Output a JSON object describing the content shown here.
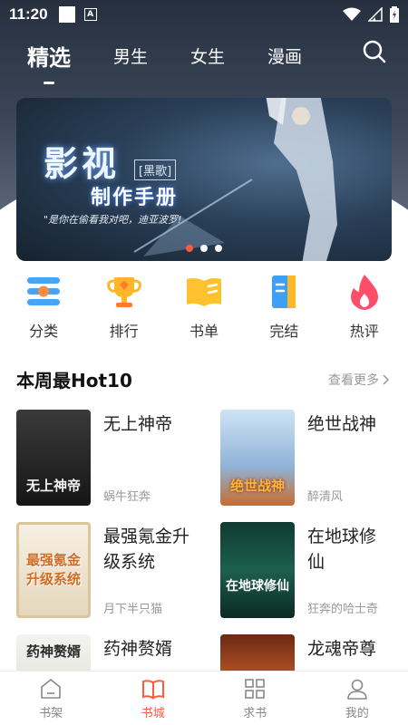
{
  "status": {
    "time": "11:20",
    "notification_letter": "A"
  },
  "top_tabs": [
    {
      "label": "精选",
      "active": true
    },
    {
      "label": "男生",
      "active": false
    },
    {
      "label": "女生",
      "active": false
    },
    {
      "label": "漫画",
      "active": false
    }
  ],
  "banner": {
    "title": "影视",
    "tag": "[黑歌]",
    "subtitle": "制作手册",
    "quote": "\"是你在偷看我对吧，迪亚波罗!",
    "total_slides": 3,
    "active_slide": 1
  },
  "categories": [
    {
      "label": "分类",
      "icon": "category-icon"
    },
    {
      "label": "排行",
      "icon": "trophy-icon"
    },
    {
      "label": "书单",
      "icon": "book-list-icon"
    },
    {
      "label": "完结",
      "icon": "finished-book-icon"
    },
    {
      "label": "热评",
      "icon": "flame-icon"
    }
  ],
  "section": {
    "title": "本周最Hot10",
    "more": "查看更多"
  },
  "books": [
    {
      "title": "无上神帝",
      "author": "蜗牛狂奔",
      "cover_text": "无上神帝"
    },
    {
      "title": "绝世战神",
      "author": "醉清风",
      "cover_text": "绝世战神"
    },
    {
      "title": "最强氪金升级系统",
      "author": "月下半只猫",
      "cover_text": "最强氪金升级系统"
    },
    {
      "title": "在地球修仙",
      "author": "狂奔的哈士奇",
      "cover_text": "在地球修仙"
    },
    {
      "title": "药神赘婿",
      "author": "",
      "cover_text": "药神赘婿"
    },
    {
      "title": "龙魂帝尊",
      "author": "",
      "cover_text": ""
    }
  ],
  "bottom_nav": [
    {
      "label": "书架",
      "icon": "bookshelf-icon",
      "active": false
    },
    {
      "label": "书城",
      "icon": "bookstore-icon",
      "active": true
    },
    {
      "label": "求书",
      "icon": "request-grid-icon",
      "active": false
    },
    {
      "label": "我的",
      "icon": "profile-icon",
      "active": false
    }
  ],
  "colors": {
    "accent": "#ff5a3c",
    "header_dark": "#26303f"
  }
}
